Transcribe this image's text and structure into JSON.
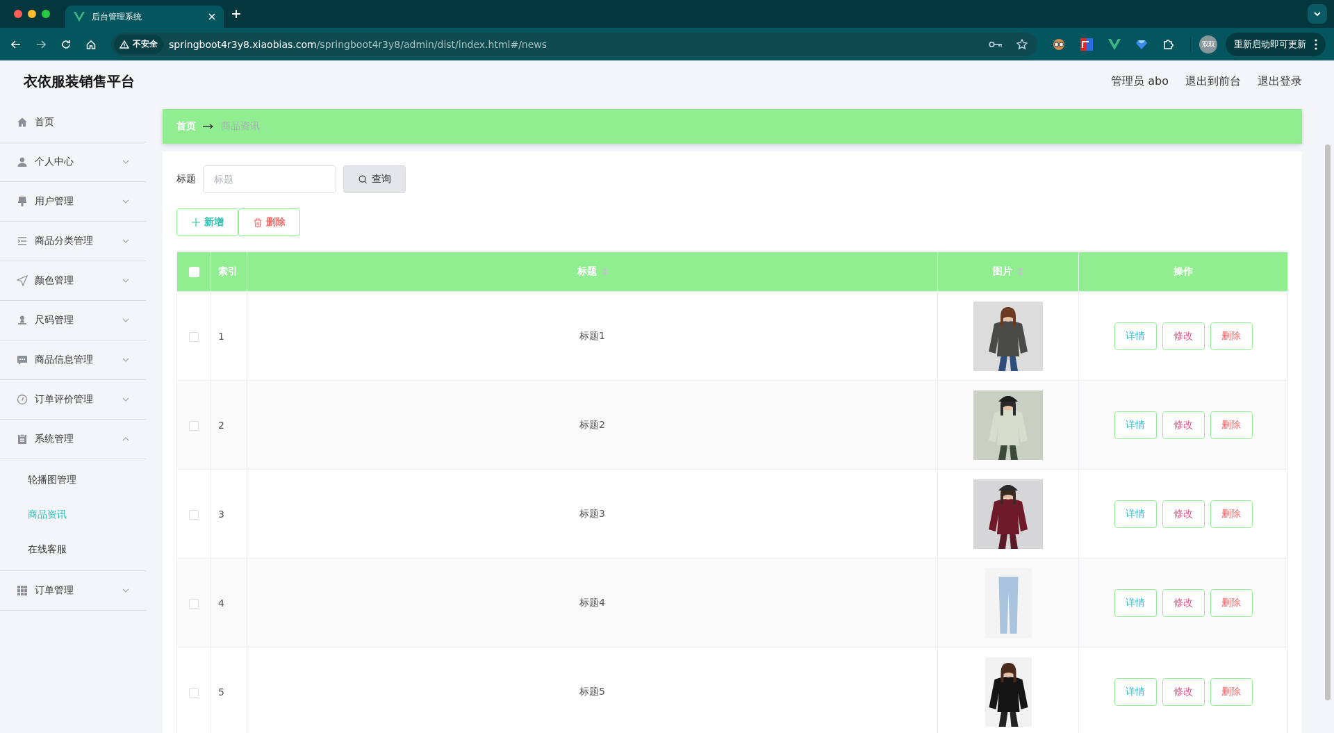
{
  "browser": {
    "tab_title": "后台管理系统",
    "security_label": "不安全",
    "url_host": "springboot4r3y8.xiaobias.com",
    "url_path": "/springboot4r3y8/admin/dist/index.html#/news",
    "avatar_text": "双双",
    "update_button": "重新启动即可更新"
  },
  "header": {
    "title": "衣依服装销售平台",
    "user": "管理员 abo",
    "links": [
      "退出到前台",
      "退出登录"
    ]
  },
  "sidebar": {
    "items": [
      {
        "label": "首页",
        "kind": "link"
      },
      {
        "label": "个人中心",
        "kind": "submenu",
        "expanded": false
      },
      {
        "label": "用户管理",
        "kind": "submenu",
        "expanded": false
      },
      {
        "label": "商品分类管理",
        "kind": "submenu",
        "expanded": false
      },
      {
        "label": "颜色管理",
        "kind": "submenu",
        "expanded": false
      },
      {
        "label": "尺码管理",
        "kind": "submenu",
        "expanded": false
      },
      {
        "label": "商品信息管理",
        "kind": "submenu",
        "expanded": false
      },
      {
        "label": "订单评价管理",
        "kind": "submenu",
        "expanded": false
      },
      {
        "label": "系统管理",
        "kind": "submenu",
        "expanded": true,
        "children": [
          {
            "label": "轮播图管理",
            "selected": false
          },
          {
            "label": "商品资讯",
            "selected": true
          },
          {
            "label": "在线客服",
            "selected": false
          }
        ]
      },
      {
        "label": "订单管理",
        "kind": "submenu",
        "expanded": false
      }
    ]
  },
  "breadcrumb": [
    "首页",
    "商品资讯"
  ],
  "search": {
    "label": "标题",
    "placeholder": "标题",
    "button": "查询"
  },
  "actions": [
    {
      "label": "新增",
      "kind": "add"
    },
    {
      "label": "删除",
      "kind": "delete"
    }
  ],
  "table": {
    "select_all": false,
    "columns": [
      {
        "label": "索引",
        "sortable": false
      },
      {
        "label": "标题",
        "sortable": true
      },
      {
        "label": "图片",
        "sortable": true
      },
      {
        "label": "操作",
        "sortable": false
      }
    ],
    "rows": [
      {
        "checked": false,
        "index": "1",
        "title": "标题1",
        "actions": [
          "详情",
          "修改",
          "删除"
        ]
      },
      {
        "checked": false,
        "index": "2",
        "title": "标题2",
        "actions": [
          "详情",
          "修改",
          "删除"
        ]
      },
      {
        "checked": false,
        "index": "3",
        "title": "标题3",
        "actions": [
          "详情",
          "修改",
          "删除"
        ]
      },
      {
        "checked": false,
        "index": "4",
        "title": "标题4",
        "actions": [
          "详情",
          "修改",
          "删除"
        ]
      },
      {
        "checked": false,
        "index": "5",
        "title": "标题5",
        "actions": [
          "详情",
          "修改",
          "删除"
        ]
      }
    ]
  }
}
